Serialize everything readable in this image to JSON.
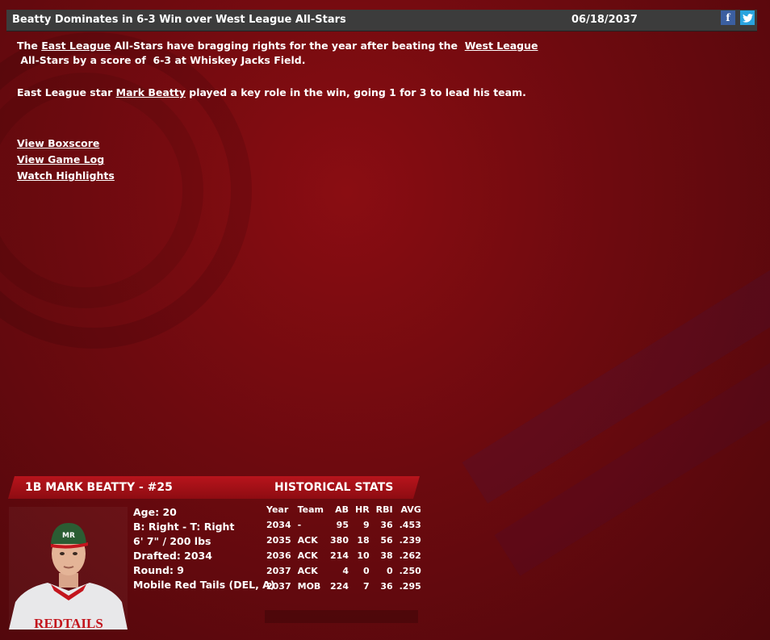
{
  "header": {
    "title": "Beatty Dominates in 6-3 Win over West League All-Stars",
    "date": "06/18/2037",
    "facebook_glyph": "f",
    "twitter_glyph": "t"
  },
  "article": {
    "p1": {
      "t1": "The ",
      "link1": "East League",
      "t2": " All-Stars have bragging rights for the year after beating the  ",
      "link2": "West League",
      "t3": " All-Stars by a score of  6-3 at Whiskey Jacks Field."
    },
    "p2": {
      "t1": "East League star ",
      "link": "Mark Beatty",
      "t2": " played a key role in the win, going 1 for 3 to lead his team."
    }
  },
  "links": {
    "boxscore": "View Boxscore",
    "gamelog": "View Game Log",
    "highlights": "Watch Highlights"
  },
  "player": {
    "name": "1B MARK BEATTY - #25",
    "section_title": "HISTORICAL STATS",
    "age": "Age: 20",
    "bats_throws": "B: Right - T: Right",
    "size": "6' 7\" / 200 lbs",
    "drafted": "Drafted: 2034",
    "round": "Round: 9",
    "team": "Mobile Red Tails (DEL, A)",
    "jersey_text": "REDTAILS",
    "cap_logo": "MR"
  },
  "stats": {
    "headers": [
      "Year",
      "Team",
      "AB",
      "HR",
      "RBI",
      "AVG"
    ],
    "rows": [
      [
        "2034",
        "-",
        "95",
        "9",
        "36",
        ".453"
      ],
      [
        "2035",
        "ACK",
        "380",
        "18",
        "56",
        ".239"
      ],
      [
        "2036",
        "ACK",
        "214",
        "10",
        "38",
        ".262"
      ],
      [
        "2037",
        "ACK",
        "4",
        "0",
        "0",
        ".250"
      ],
      [
        "2037",
        "MOB",
        "224",
        "7",
        "36",
        ".295"
      ]
    ]
  }
}
